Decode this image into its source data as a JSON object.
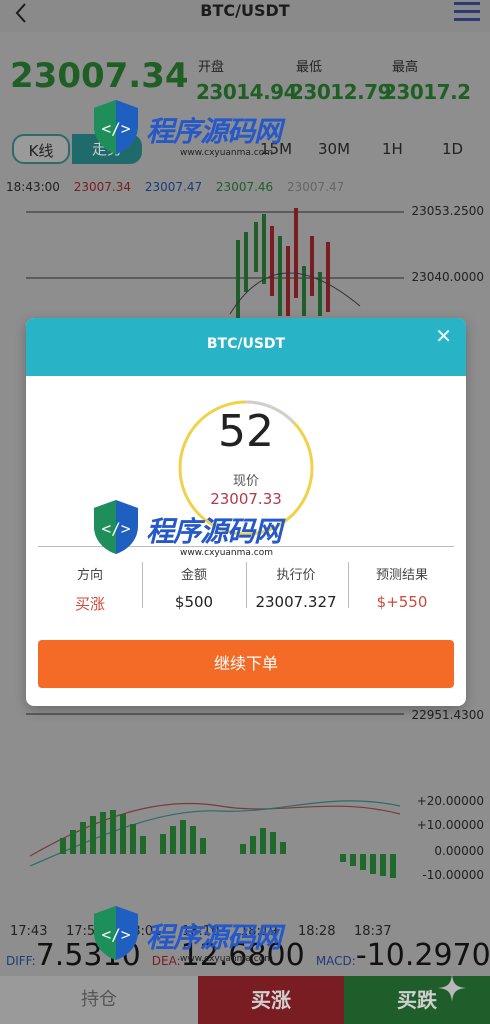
{
  "header": {
    "title": "BTC/USDT"
  },
  "ticker": {
    "price": "23007.34",
    "labels": {
      "open": "开盘",
      "low": "最低",
      "high": "最高"
    },
    "values": {
      "open": "23014.94",
      "low": "23012.79",
      "high": "23017.2"
    }
  },
  "tabs": [
    "K线",
    "走势",
    "15M",
    "30M",
    "1H",
    "1D"
  ],
  "info_row": [
    "18:43:00",
    "23007.34",
    "23007.47",
    "23007.46",
    "23007.47"
  ],
  "chart_axis": {
    "prices": [
      "23053.2500",
      "23040.0000",
      "22951.4300"
    ],
    "times": [
      "17:43",
      "17:52",
      "18:01",
      "18:10",
      "18:19",
      "18:28",
      "18:37"
    ],
    "macd_labels": {
      "diff": "DIFF:",
      "dea": "DEA:",
      "macd": "MACD:"
    },
    "macd_values": {
      "diff": "7.5310",
      "dea": "12.6800",
      "macd": "-10.2970"
    },
    "macd_scale": [
      "+20.00000",
      "+10.00000",
      "0.00000",
      "-10.00000"
    ]
  },
  "modal": {
    "title": "BTC/USDT",
    "countdown": "52",
    "current_label": "现价",
    "current_price": "23007.33",
    "cells": [
      {
        "header": "方向",
        "value": "买涨"
      },
      {
        "header": "金额",
        "value": "$500"
      },
      {
        "header": "执行价",
        "value": "23007.327"
      },
      {
        "header": "预测结果",
        "value": "$+550"
      }
    ],
    "continue_label": "继续下单"
  },
  "bottom": {
    "hold": "持仓",
    "buy_up": "买涨",
    "buy_down": "买跌"
  },
  "watermark": {
    "name": "程序源码网",
    "url": "www.cxyuanma.com"
  },
  "colors": {
    "accent": "#29b3c7",
    "order_button": "#f36b26",
    "up": "#7a1d23",
    "down": "#1f5e2a"
  }
}
